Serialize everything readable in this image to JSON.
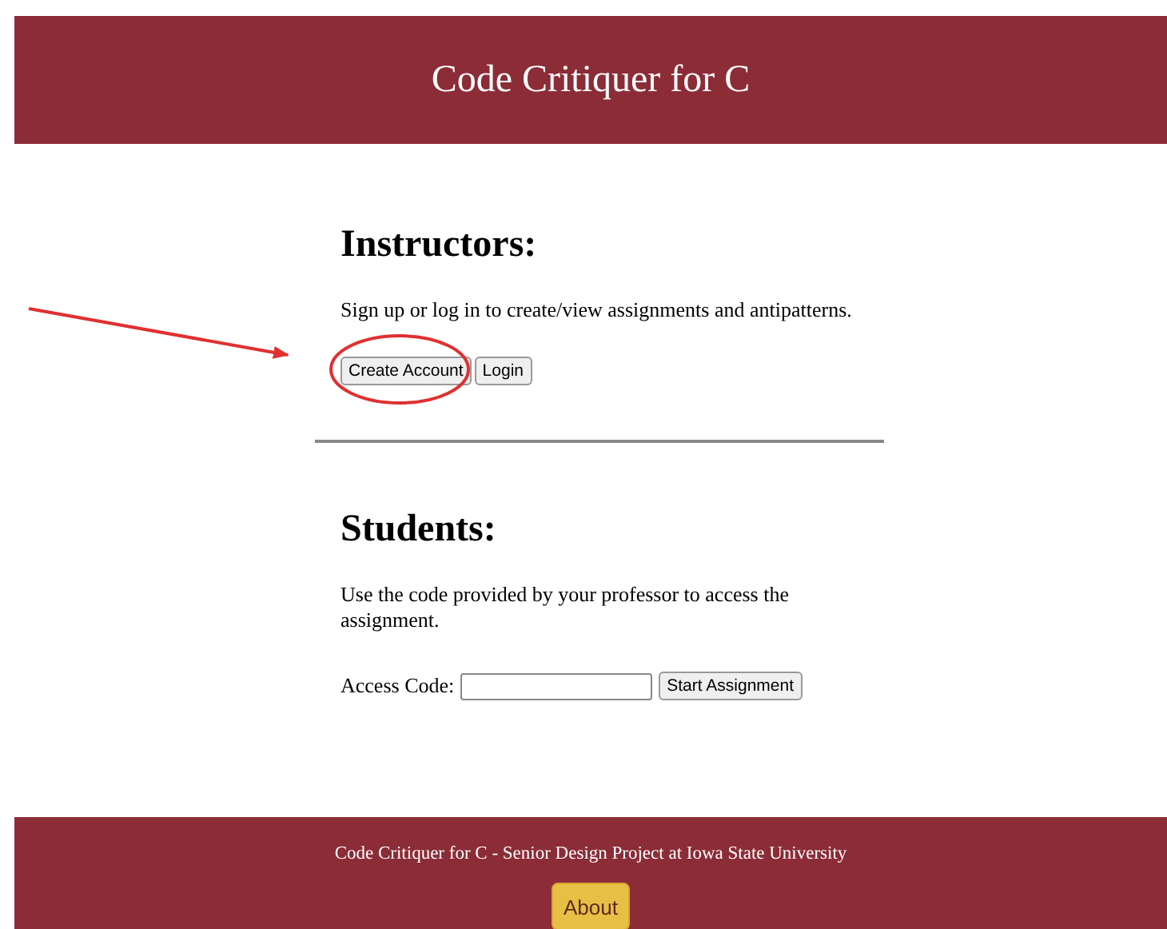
{
  "header": {
    "title": "Code Critiquer for C"
  },
  "instructors": {
    "heading": "Instructors:",
    "text": "Sign up or log in to create/view assignments and antipatterns.",
    "buttons": [
      "Create Account",
      "Login"
    ]
  },
  "students": {
    "heading": "Students:",
    "text": "Use the code provided by your professor to access the assignment.",
    "field_label": "Access Code:",
    "button": "Start Assignment"
  },
  "footer": {
    "text": "Code Critiquer for C - Senior Design Project at Iowa State University",
    "button": "About"
  }
}
